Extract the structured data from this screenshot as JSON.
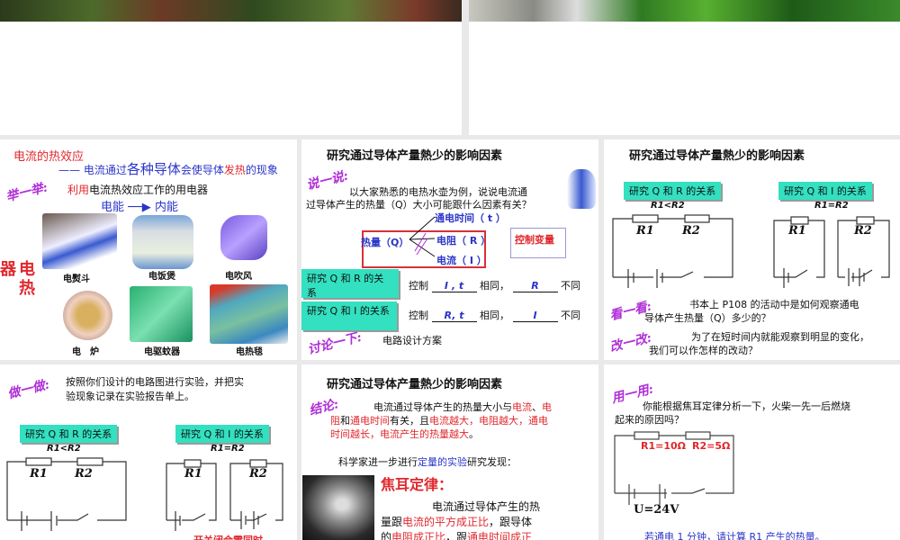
{
  "slide1": {
    "title": "电流的热效应",
    "def_prefix": "—— 电流通过",
    "def_big": "各种导体",
    "def_mid": "会使导体",
    "def_red": "发热",
    "def_suffix": "的现象",
    "tag": "举一举:",
    "use_red": "利用",
    "use_rest": "电流热效应工作的用电器",
    "energy_from": "电能",
    "energy_to": "内能",
    "side_label_1": "器",
    "side_label_2": "电",
    "side_label_3": "热",
    "devices": [
      "电熨斗",
      "电饭煲",
      "电吹风",
      "电　炉",
      "电驱蚊器",
      "电热毯"
    ]
  },
  "slide2": {
    "title": "研究通过导体产量熱少的影响因素",
    "tag": "说一说:",
    "question_1": "以大家熟悉的电热水壶为例，说说电流通",
    "question_2": "过导体产生的热量（Q）大小可能跟什么因素有关？",
    "factor_t": "通电时间（ t ）",
    "heat": "热量（Q）",
    "factor_r": "电阻（ R ）",
    "factor_i": "电流（ I ）",
    "control_var": "控制变量",
    "study_r": "研究 Q 和 R 的关系",
    "study_i": "研究 Q 和 I 的关系",
    "control": "控制",
    "same": "相同，",
    "diff": "不同",
    "row1_same": "I , t",
    "row1_diff": "R",
    "row2_same": "R, t",
    "row2_diff": "I",
    "discuss_tag": "讨论一下:",
    "discuss_text": "电路设计方案"
  },
  "slide3": {
    "title": "研究通过导体产量熱少的影响因素",
    "study_r": "研究 Q 和 R 的关系",
    "study_i": "研究 Q 和 I 的关系",
    "cond_r": "R1<R2",
    "cond_i": "R1=R2",
    "r1": "R1",
    "r2": "R2",
    "look_tag": "看一看:",
    "look_1": "书本上 P108 的活动中是如何观察通电",
    "look_2": "导体产生热量（Q）多少的？",
    "change_tag": "改一改:",
    "change_1": "为了在短时间内就能观察到明显的变化，",
    "change_2": "我们可以作怎样的改动？"
  },
  "slide4": {
    "tag": "做一做:",
    "text_1": "按照你们设计的电路图进行实验，并把实",
    "text_2": "验现象记录在实验报告单上。",
    "study_r": "研究 Q 和 R 的关系",
    "study_i": "研究 Q 和 I 的关系",
    "cond_r": "R1<R2",
    "cond_i": "R1=R2",
    "r1": "R1",
    "r2": "R2",
    "note": "开关闭合需同时"
  },
  "slide5": {
    "title": "研究通过导体产量熱少的影响因素",
    "tag": "结论:",
    "c1a": "电流通过导体产生的热量大小与",
    "c1b": "电流",
    "c1c": "、",
    "c1d": "电",
    "c2a": "阻",
    "c2b": "和",
    "c2c": "通电时间",
    "c2d": "有关，且",
    "c2e": "电流越大，电阻越大，通电",
    "c3a": "时间越长，电流产生的热量越大",
    "c3b": "。",
    "sci_a": "科学家进一步进行",
    "sci_b": "定量的实验",
    "sci_c": "研究发现：",
    "law": "焦耳定律：",
    "l1": "电流通过导体产生的热",
    "l2a": "量跟",
    "l2b": "电流的平方成正比",
    "l2c": "，跟导体",
    "l3a": "的",
    "l3b": "电阻成正比",
    "l3c": "，跟",
    "l3d": "通电时间成正"
  },
  "slide6": {
    "tag": "用一用:",
    "q1": "你能根据焦耳定律分析一下，火柴一先一后燃烧",
    "q2": "起来的原因吗？",
    "r1": "R1=10Ω",
    "r2": "R2=5Ω",
    "voltage": "U=24V",
    "task": "若通电 1 分钟，请计算 R1 产生的热量。"
  }
}
